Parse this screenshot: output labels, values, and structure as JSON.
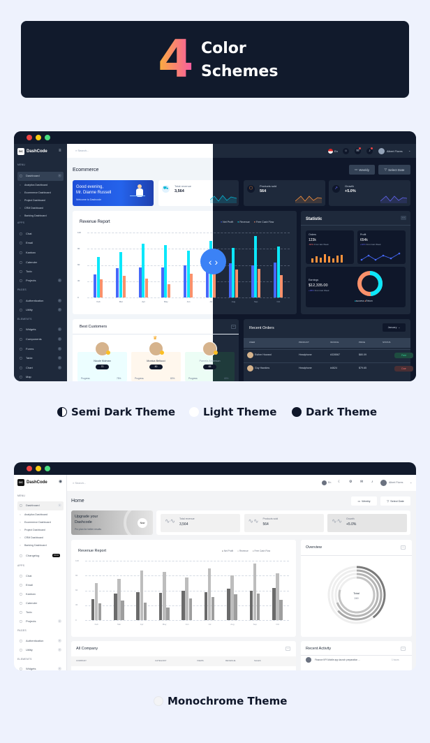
{
  "banner": {
    "number": "4",
    "line1": "Color",
    "line2": "Schemes"
  },
  "themes": [
    {
      "label": "Semi Dark Theme"
    },
    {
      "label": "Light Theme"
    },
    {
      "label": "Dark Theme"
    },
    {
      "label": "Monochrome Theme"
    }
  ],
  "colors": {
    "net_profit": "#4669fa",
    "revenue": "#0ce7fa",
    "free_cash_flow": "#fa916b",
    "dark_bg": "#0f172a",
    "dark_card": "#1e293b",
    "toggle": "#3b82f6"
  },
  "preview1": {
    "brand": "DashCode",
    "search_placeholder": "Search...",
    "sidebar": {
      "menu": "MENU",
      "dashboard": "Dashboard",
      "subitems": [
        "Analytics Dashboard",
        "Ecommerce Dashboard",
        "Project Dashboard",
        "CRM Dashboard",
        "Banking Dashboard"
      ],
      "apps_heading": "APPS",
      "apps": [
        "Chat",
        "Email",
        "Kanban",
        "Calender",
        "Todo",
        "Projects"
      ],
      "pages_heading": "PAGES",
      "pages": [
        "Authentication",
        "Utility"
      ],
      "elements_heading": "ELEMENTS",
      "elements": [
        "Widgets",
        "Components",
        "Forms",
        "Table",
        "Chart",
        "Map"
      ]
    },
    "header": {
      "lang": "En",
      "user": "Albert Flores"
    },
    "page_title": "Ecommerce",
    "weekly": "Weekly",
    "select_date": "Select Date",
    "welcome": {
      "line1": "Good evening,",
      "line2": "Mr. Dianne Russell",
      "sub": "Welcome to Dashcode"
    },
    "stats": [
      {
        "label": "Total revenue",
        "value": "3,564"
      },
      {
        "label": "Products sold",
        "value": "564"
      },
      {
        "label": "Growth",
        "value": "+5.0%"
      }
    ],
    "revenue_title": "Revenue Report",
    "statistic": {
      "title": "Statistic",
      "orders": {
        "label": "Orders",
        "value": "123k",
        "change": "-60%",
        "note": "From last Week"
      },
      "profit": {
        "label": "Profit",
        "value": "654k",
        "change": "+02%",
        "note": "From last Week"
      },
      "earnings": {
        "label": "Earnings",
        "value": "$12,335.00",
        "change": "+08%",
        "note": "From last Week",
        "legend": [
          "success",
          "Return"
        ]
      }
    },
    "customers": {
      "title": "Best Customers",
      "items": [
        {
          "name": "Nicole Kidman",
          "score": "70",
          "progress_label": "Progress",
          "percent": "75%"
        },
        {
          "name": "Monica Bellucci",
          "score": "80",
          "progress_label": "Progress",
          "percent": "80%"
        },
        {
          "name": "Pamela Anderson",
          "score": "65",
          "progress_label": "Progress",
          "percent": "65%"
        }
      ]
    },
    "orders": {
      "title": "Recent Orders",
      "filter": "January",
      "columns": [
        "USER",
        "PRODUCT",
        "INVOICE",
        "PRICE",
        "STATUS"
      ],
      "rows": [
        {
          "user": "Esther Howard",
          "product": "Headphone",
          "invoice": "#328567",
          "price": "$80.09",
          "status": "Paid"
        },
        {
          "user": "Guy Hawkins",
          "product": "Headphone",
          "invoice": "#4624",
          "price": "$79.65",
          "status": "Due"
        }
      ]
    }
  },
  "preview2": {
    "brand": "DashCode",
    "search_placeholder": "Search...",
    "sidebar": {
      "menu": "MENU",
      "dashboard": "Dashboard",
      "subitems": [
        "Analytics Dashboard",
        "Ecommerce Dashboard",
        "Project Dashboard",
        "CRM Dashboard",
        "Banking Dashboard"
      ],
      "changelog": "Changelog",
      "changelog_badge": "3.0.0",
      "apps_heading": "APPS",
      "apps": [
        "Chat",
        "Email",
        "Kanban",
        "Calender",
        "Todo",
        "Projects"
      ],
      "pages_heading": "PAGES",
      "pages": [
        "Authentication",
        "Utility"
      ],
      "elements_heading": "ELEMENTS",
      "elements": [
        "Widgets"
      ]
    },
    "header": {
      "lang": "En",
      "user": "Albert Flores"
    },
    "page_title": "Home",
    "weekly": "Weekly",
    "select_date": "Select Date",
    "upgrade": {
      "line1": "Upgrade your",
      "line2": "Dashcode",
      "sub": "Pro plan for better results",
      "button": "Now"
    },
    "stats": [
      {
        "label": "Total revenue",
        "value": "3,564"
      },
      {
        "label": "Products sold",
        "value": "564"
      },
      {
        "label": "Growth",
        "value": "+5.0%"
      }
    ],
    "revenue_title": "Revenue Report",
    "overview": {
      "title": "Overview",
      "total_label": "Total",
      "total": "249"
    },
    "company": {
      "title": "All Company",
      "columns": [
        "COMPANY",
        "CATEGORY",
        "VIEWS",
        "REVENUE",
        "SALES"
      ]
    },
    "activity": {
      "title": "Recent Activity",
      "items": [
        {
          "text": "Finance KPI Mobile app launch preparation ...",
          "time": "1 hours"
        }
      ]
    }
  },
  "chart_data": {
    "type": "bar",
    "title": "Revenue Report",
    "categories": [
      "Feb",
      "Mar",
      "Apr",
      "May",
      "Jun",
      "Jul",
      "Aug",
      "Sep",
      "Oct"
    ],
    "series": [
      {
        "name": "Net Profit",
        "values": [
          43,
          54,
          56,
          55,
          60,
          57,
          63,
          59,
          65
        ]
      },
      {
        "name": "Revenue",
        "values": [
          75,
          84,
          100,
          97,
          86,
          104,
          91,
          114,
          94
        ]
      },
      {
        "name": "Free Cash Flow",
        "values": [
          34,
          40,
          35,
          25,
          44,
          47,
          52,
          53,
          41
        ]
      }
    ],
    "ylim": [
      0,
      120
    ],
    "yticks": [
      "120",
      "90",
      "60",
      "30",
      "0"
    ],
    "grid": true,
    "legend": "top-right"
  }
}
